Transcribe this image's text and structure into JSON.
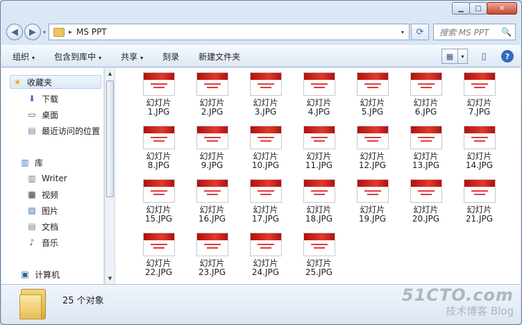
{
  "window": {
    "caption": {
      "minimize": "▁",
      "maximize": "□",
      "close": "✕"
    }
  },
  "address_bar": {
    "back": "◀",
    "forward": "▶",
    "recent_dropdown": "▾",
    "separator": "▸",
    "path": "MS PPT",
    "dropdown": "▾",
    "refresh": "⟳",
    "search_placeholder": "搜索 MS PPT",
    "search_icon": "🔍"
  },
  "toolbar": {
    "organize": "组织",
    "include_in_library": "包含到库中",
    "share": "共享",
    "burn": "刻录",
    "new_folder": "新建文件夹",
    "arrow": "▾",
    "view_icon": "▦",
    "view_drop": "▾",
    "preview_pane_icon": "▯",
    "help_icon": "?"
  },
  "nav_pane": {
    "favorites": {
      "label": "收藏夹",
      "icon": "★"
    },
    "downloads": {
      "label": "下载",
      "icon": "⬇"
    },
    "desktop": {
      "label": "桌面",
      "icon": "▭"
    },
    "recent": {
      "label": "最近访问的位置",
      "icon": "▤"
    },
    "libraries": {
      "label": "库",
      "icon": "▥"
    },
    "writer": {
      "label": "Writer",
      "icon": "▥"
    },
    "videos": {
      "label": "视频",
      "icon": "▦"
    },
    "pictures": {
      "label": "图片",
      "icon": "▧"
    },
    "documents": {
      "label": "文档",
      "icon": "▤"
    },
    "music": {
      "label": "音乐",
      "icon": "♪"
    },
    "computer": {
      "label": "计算机",
      "icon": "▣"
    },
    "scroll_up": "▲",
    "scroll_down": "▼"
  },
  "files": [
    {
      "line1": "幻灯片",
      "line2": "1.JPG"
    },
    {
      "line1": "幻灯片",
      "line2": "2.JPG"
    },
    {
      "line1": "幻灯片",
      "line2": "3.JPG"
    },
    {
      "line1": "幻灯片",
      "line2": "4.JPG"
    },
    {
      "line1": "幻灯片",
      "line2": "5.JPG"
    },
    {
      "line1": "幻灯片",
      "line2": "6.JPG"
    },
    {
      "line1": "幻灯片",
      "line2": "7.JPG"
    },
    {
      "line1": "幻灯片",
      "line2": "8.JPG"
    },
    {
      "line1": "幻灯片",
      "line2": "9.JPG"
    },
    {
      "line1": "幻灯片",
      "line2": "10.JPG"
    },
    {
      "line1": "幻灯片",
      "line2": "11.JPG"
    },
    {
      "line1": "幻灯片",
      "line2": "12.JPG"
    },
    {
      "line1": "幻灯片",
      "line2": "13.JPG"
    },
    {
      "line1": "幻灯片",
      "line2": "14.JPG"
    },
    {
      "line1": "幻灯片",
      "line2": "15.JPG"
    },
    {
      "line1": "幻灯片",
      "line2": "16.JPG"
    },
    {
      "line1": "幻灯片",
      "line2": "17.JPG"
    },
    {
      "line1": "幻灯片",
      "line2": "18.JPG"
    },
    {
      "line1": "幻灯片",
      "line2": "19.JPG"
    },
    {
      "line1": "幻灯片",
      "line2": "20.JPG"
    },
    {
      "line1": "幻灯片",
      "line2": "21.JPG"
    },
    {
      "line1": "幻灯片",
      "line2": "22.JPG"
    },
    {
      "line1": "幻灯片",
      "line2": "23.JPG"
    },
    {
      "line1": "幻灯片",
      "line2": "24.JPG"
    },
    {
      "line1": "幻灯片",
      "line2": "25.JPG"
    }
  ],
  "details": {
    "item_count": "25 个对象"
  },
  "watermark": {
    "site": "51CTO.com",
    "sub": "技术博客 Blog"
  }
}
